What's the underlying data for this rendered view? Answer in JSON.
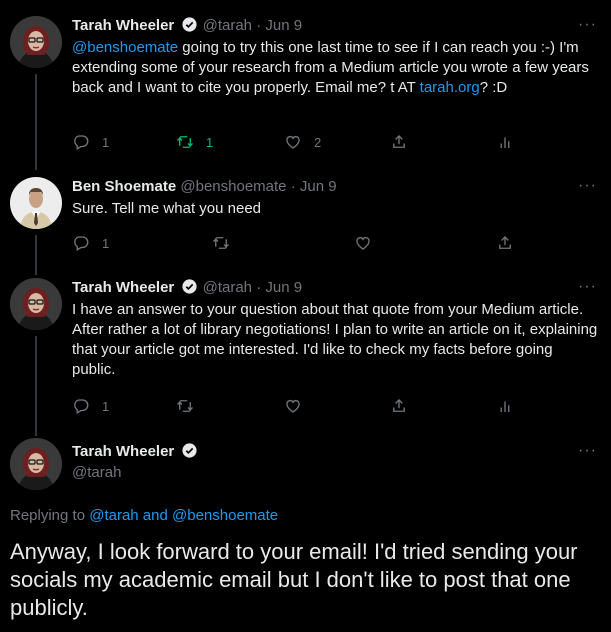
{
  "tweets": [
    {
      "name": "Tarah Wheeler",
      "handle": "@tarah",
      "sep": "·",
      "date": "Jun 9",
      "mention": "@benshoemate",
      "text_a": " going to try this one last time to see if I can reach you :-) I'm extending some of your research from a Medium article you wrote a few years back and I want to cite you properly. Email me? t AT ",
      "link": "tarah.org",
      "text_b": "? :D",
      "replies": "1",
      "retweets": "1",
      "likes": "2"
    },
    {
      "name": "Ben Shoemate",
      "handle": "@benshoemate",
      "sep": "·",
      "date": "Jun 9",
      "text": "Sure. Tell me what you need",
      "replies": "1"
    },
    {
      "name": "Tarah Wheeler",
      "handle": "@tarah",
      "sep": "·",
      "date": "Jun 9",
      "text": "I have an answer to your question about that quote from your Medium article. After rather a lot of library negotiations! I plan to write an article on it, explaining that your article got me interested. I'd like to check my facts before going public.",
      "replies": "1"
    }
  ],
  "main": {
    "name": "Tarah Wheeler",
    "handle": "@tarah",
    "replying_prefix": "Replying to ",
    "reply_user1": "@tarah",
    "reply_and": " and ",
    "reply_user2": "@benshoemate",
    "text": "Anyway, I look forward to your email! I'd tried sending your socials my academic email but I don't like to post that one publicly."
  },
  "more_label": "···",
  "colors": {
    "accent": "#1d9bf0",
    "retweet_active": "#00ba7c",
    "muted": "#71767b",
    "background": "#000000"
  }
}
